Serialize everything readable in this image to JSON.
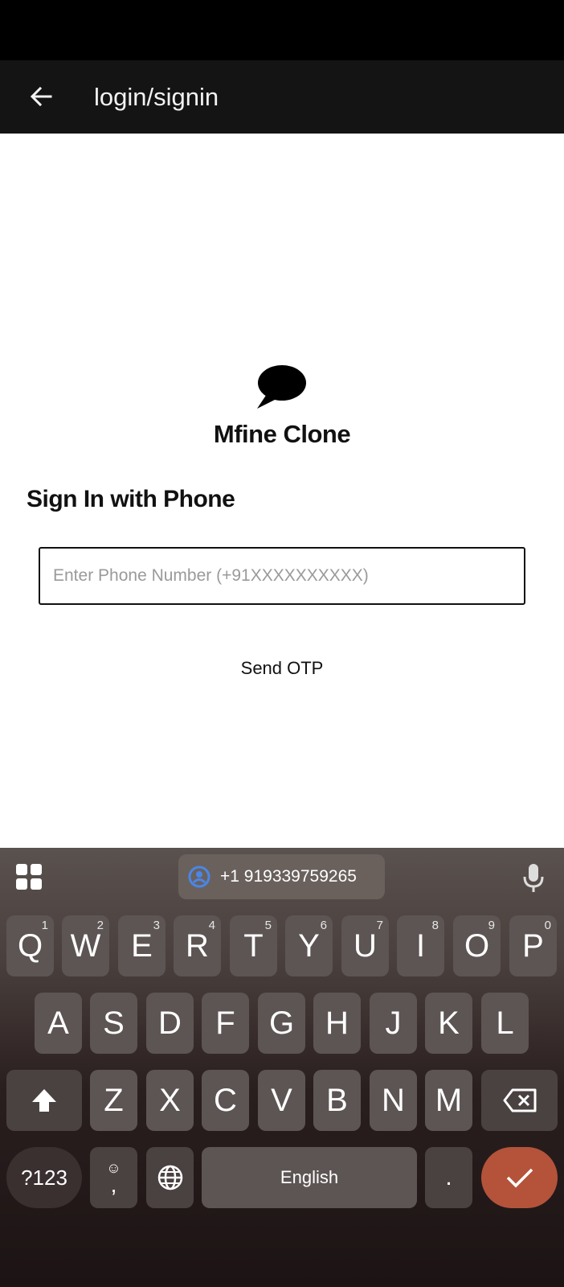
{
  "app_bar": {
    "title": "login/signin",
    "back_icon": "arrow-left-icon"
  },
  "content": {
    "logo_icon": "chat-bubble-icon",
    "brand_name": "Mfine Clone",
    "section_title": "Sign In with Phone",
    "phone_input": {
      "value": "",
      "placeholder": "Enter Phone Number (+91XXXXXXXXXX)"
    },
    "send_otp_label": "Send OTP"
  },
  "keyboard": {
    "suggestion": "+1 919339759265",
    "row1": [
      {
        "label": "Q",
        "hint": "1"
      },
      {
        "label": "W",
        "hint": "2"
      },
      {
        "label": "E",
        "hint": "3"
      },
      {
        "label": "R",
        "hint": "4"
      },
      {
        "label": "T",
        "hint": "5"
      },
      {
        "label": "Y",
        "hint": "6"
      },
      {
        "label": "U",
        "hint": "7"
      },
      {
        "label": "I",
        "hint": "8"
      },
      {
        "label": "O",
        "hint": "9"
      },
      {
        "label": "P",
        "hint": "0"
      }
    ],
    "row2": [
      "A",
      "S",
      "D",
      "F",
      "G",
      "H",
      "J",
      "K",
      "L"
    ],
    "row3": [
      "Z",
      "X",
      "C",
      "V",
      "B",
      "N",
      "M"
    ],
    "symbols_label": "?123",
    "comma_label": ",",
    "space_label": "English",
    "period_label": ".",
    "colors": {
      "enter": "#b4533a",
      "accent_icon": "#4a86e8"
    }
  }
}
